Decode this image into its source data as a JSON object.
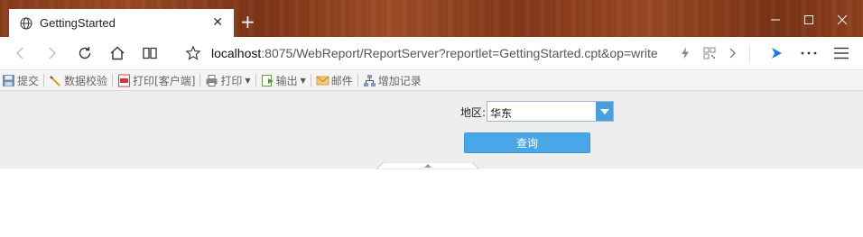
{
  "browser": {
    "tab_title": "GettingStarted",
    "url_host": "localhost",
    "url_rest": ":8075/WebReport/ReportServer?reportlet=GettingStarted.cpt&op=write"
  },
  "toolbar": {
    "items": [
      {
        "label": "提交",
        "icon": "save-icon"
      },
      {
        "label": "数据校验",
        "icon": "pencil-check-icon"
      },
      {
        "label": "打印[客户端]",
        "icon": "pdf-print-icon"
      },
      {
        "label": "打印",
        "icon": "printer-icon"
      },
      {
        "label": "输出",
        "icon": "export-icon"
      },
      {
        "label": "邮件",
        "icon": "mail-icon"
      },
      {
        "label": "增加记录",
        "icon": "add-record-icon"
      }
    ]
  },
  "params": {
    "region_label": "地区:",
    "region_value": "华东",
    "query_label": "查询"
  },
  "colors": {
    "accent": "#49a7e8",
    "combo_arrow": "#4a9ede",
    "toolbar_bg": "#f4f4f4",
    "param_bg": "#eeeeee"
  }
}
